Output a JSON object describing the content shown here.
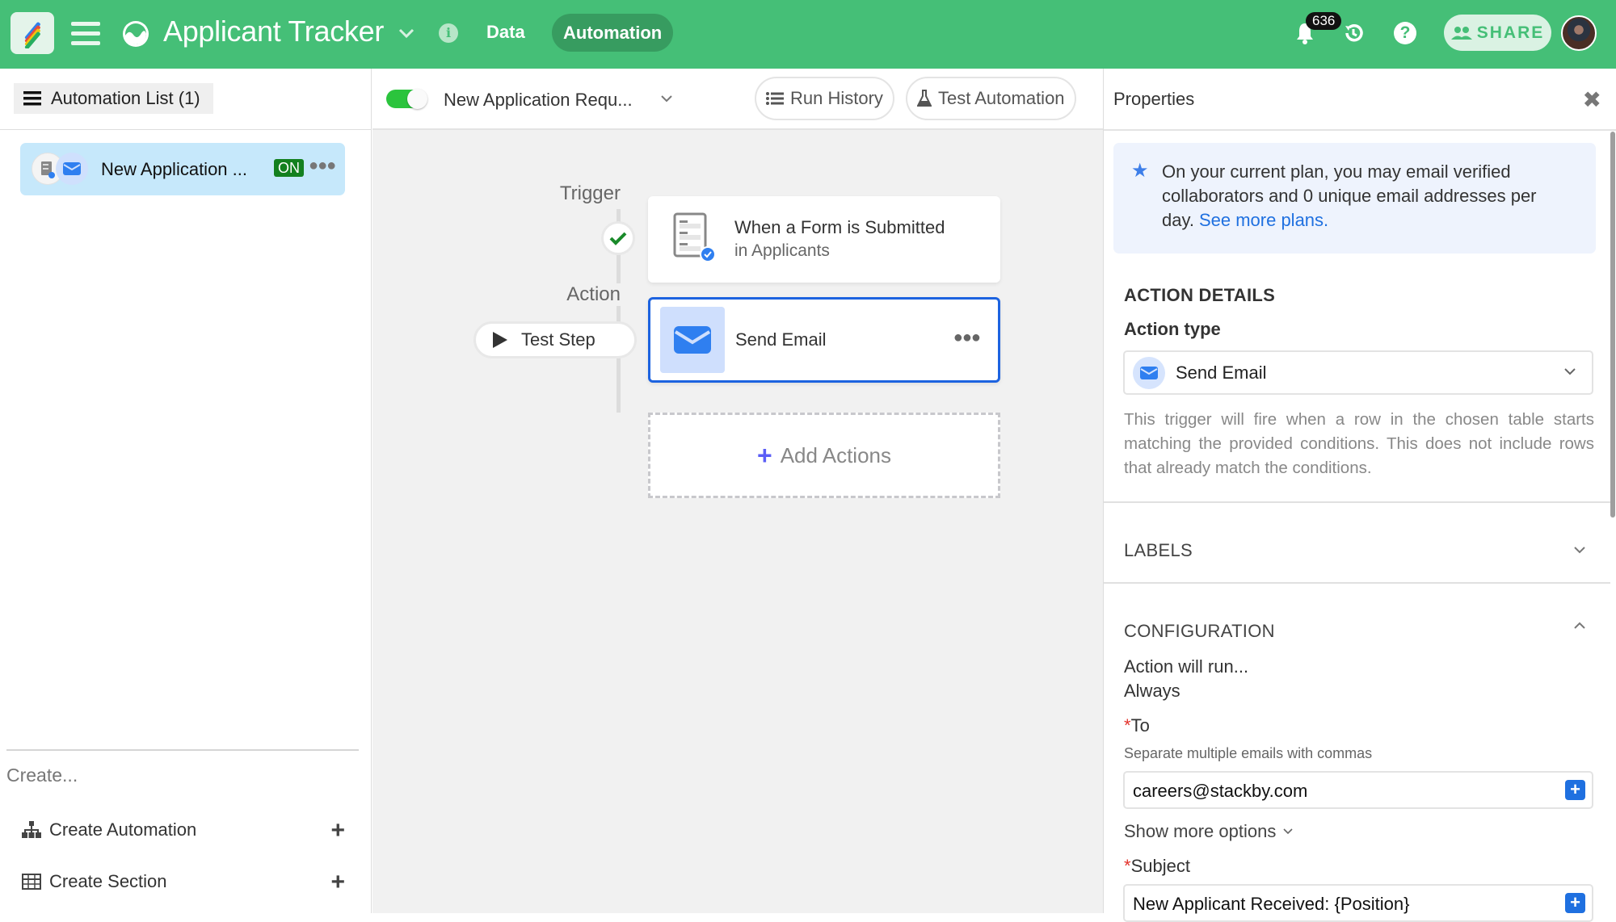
{
  "header": {
    "app_title": "Applicant Tracker",
    "nav": [
      {
        "label": "Data",
        "active": false
      },
      {
        "label": "Automation",
        "active": true
      }
    ],
    "notification_count": "636",
    "share_label": "SHARE",
    "brand_color": "#45bf77"
  },
  "left_panel": {
    "list_button_label": "Automation List (1)",
    "automations": [
      {
        "label": "New Application ...",
        "status": "ON"
      }
    ],
    "create_heading": "Create...",
    "create_items": [
      {
        "label": "Create Automation",
        "icon": "sitemap-icon"
      },
      {
        "label": "Create Section",
        "icon": "table-icon"
      }
    ]
  },
  "toolbar": {
    "automation_name": "New Application Requ...",
    "enabled": true,
    "run_history_label": "Run History",
    "test_automation_label": "Test Automation"
  },
  "canvas": {
    "trigger_label": "Trigger",
    "action_label": "Action",
    "test_step_label": "Test Step",
    "trigger_card": {
      "title": "When a Form is Submitted",
      "subtitle": "in Applicants"
    },
    "action_card": {
      "title": "Send Email"
    },
    "add_actions_label": "Add Actions"
  },
  "properties": {
    "title": "Properties",
    "plan_notice": "On your current plan, you may email verified collaborators and 0 unique email addresses per day.",
    "plan_link": "See more plans.",
    "action_details_heading": "ACTION DETAILS",
    "action_type_label": "Action type",
    "action_type_value": "Send Email",
    "description": "This trigger will fire when a row in the chosen table starts matching the provided conditions. This does not include rows that already match the conditions.",
    "labels_heading": "LABELS",
    "configuration_heading": "CONFIGURATION",
    "action_will_run_label": "Action will run...",
    "action_will_run_value": "Always",
    "to_label": "To",
    "to_hint": "Separate multiple emails with commas",
    "to_value": "careers@stackby.com",
    "show_more_label": "Show more options",
    "subject_label": "Subject",
    "subject_value": "New Applicant Received: {Position}",
    "required_marker": "*"
  }
}
